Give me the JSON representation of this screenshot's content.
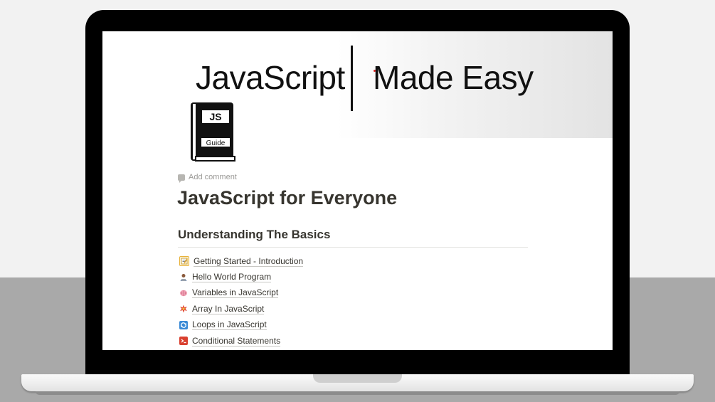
{
  "cover": {
    "left_text": "JavaScript",
    "right_text": "Made Easy"
  },
  "page_icon": {
    "icon": "book-icon",
    "top_label": "JS",
    "bottom_label": "Guide"
  },
  "add_comment_label": "Add comment",
  "page_title": "JavaScript for Everyone",
  "section": {
    "heading": "Understanding The Basics",
    "links": [
      {
        "label": "Getting Started - Introduction",
        "icon": "memo-icon",
        "color": "#e8b23a"
      },
      {
        "label": "Hello World Program",
        "icon": "technologist-icon",
        "color": "#8a5a3c"
      },
      {
        "label": "Variables in JavaScript",
        "icon": "brain-icon",
        "color": "#f19fb3"
      },
      {
        "label": "Array In JavaScript",
        "icon": "collision-icon",
        "color": "#e0452f"
      },
      {
        "label": "Loops in JavaScript",
        "icon": "repeat-icon",
        "color": "#3a8ad6"
      },
      {
        "label": "Conditional Statements",
        "icon": "terminal-icon",
        "color": "#d9402f"
      }
    ]
  }
}
